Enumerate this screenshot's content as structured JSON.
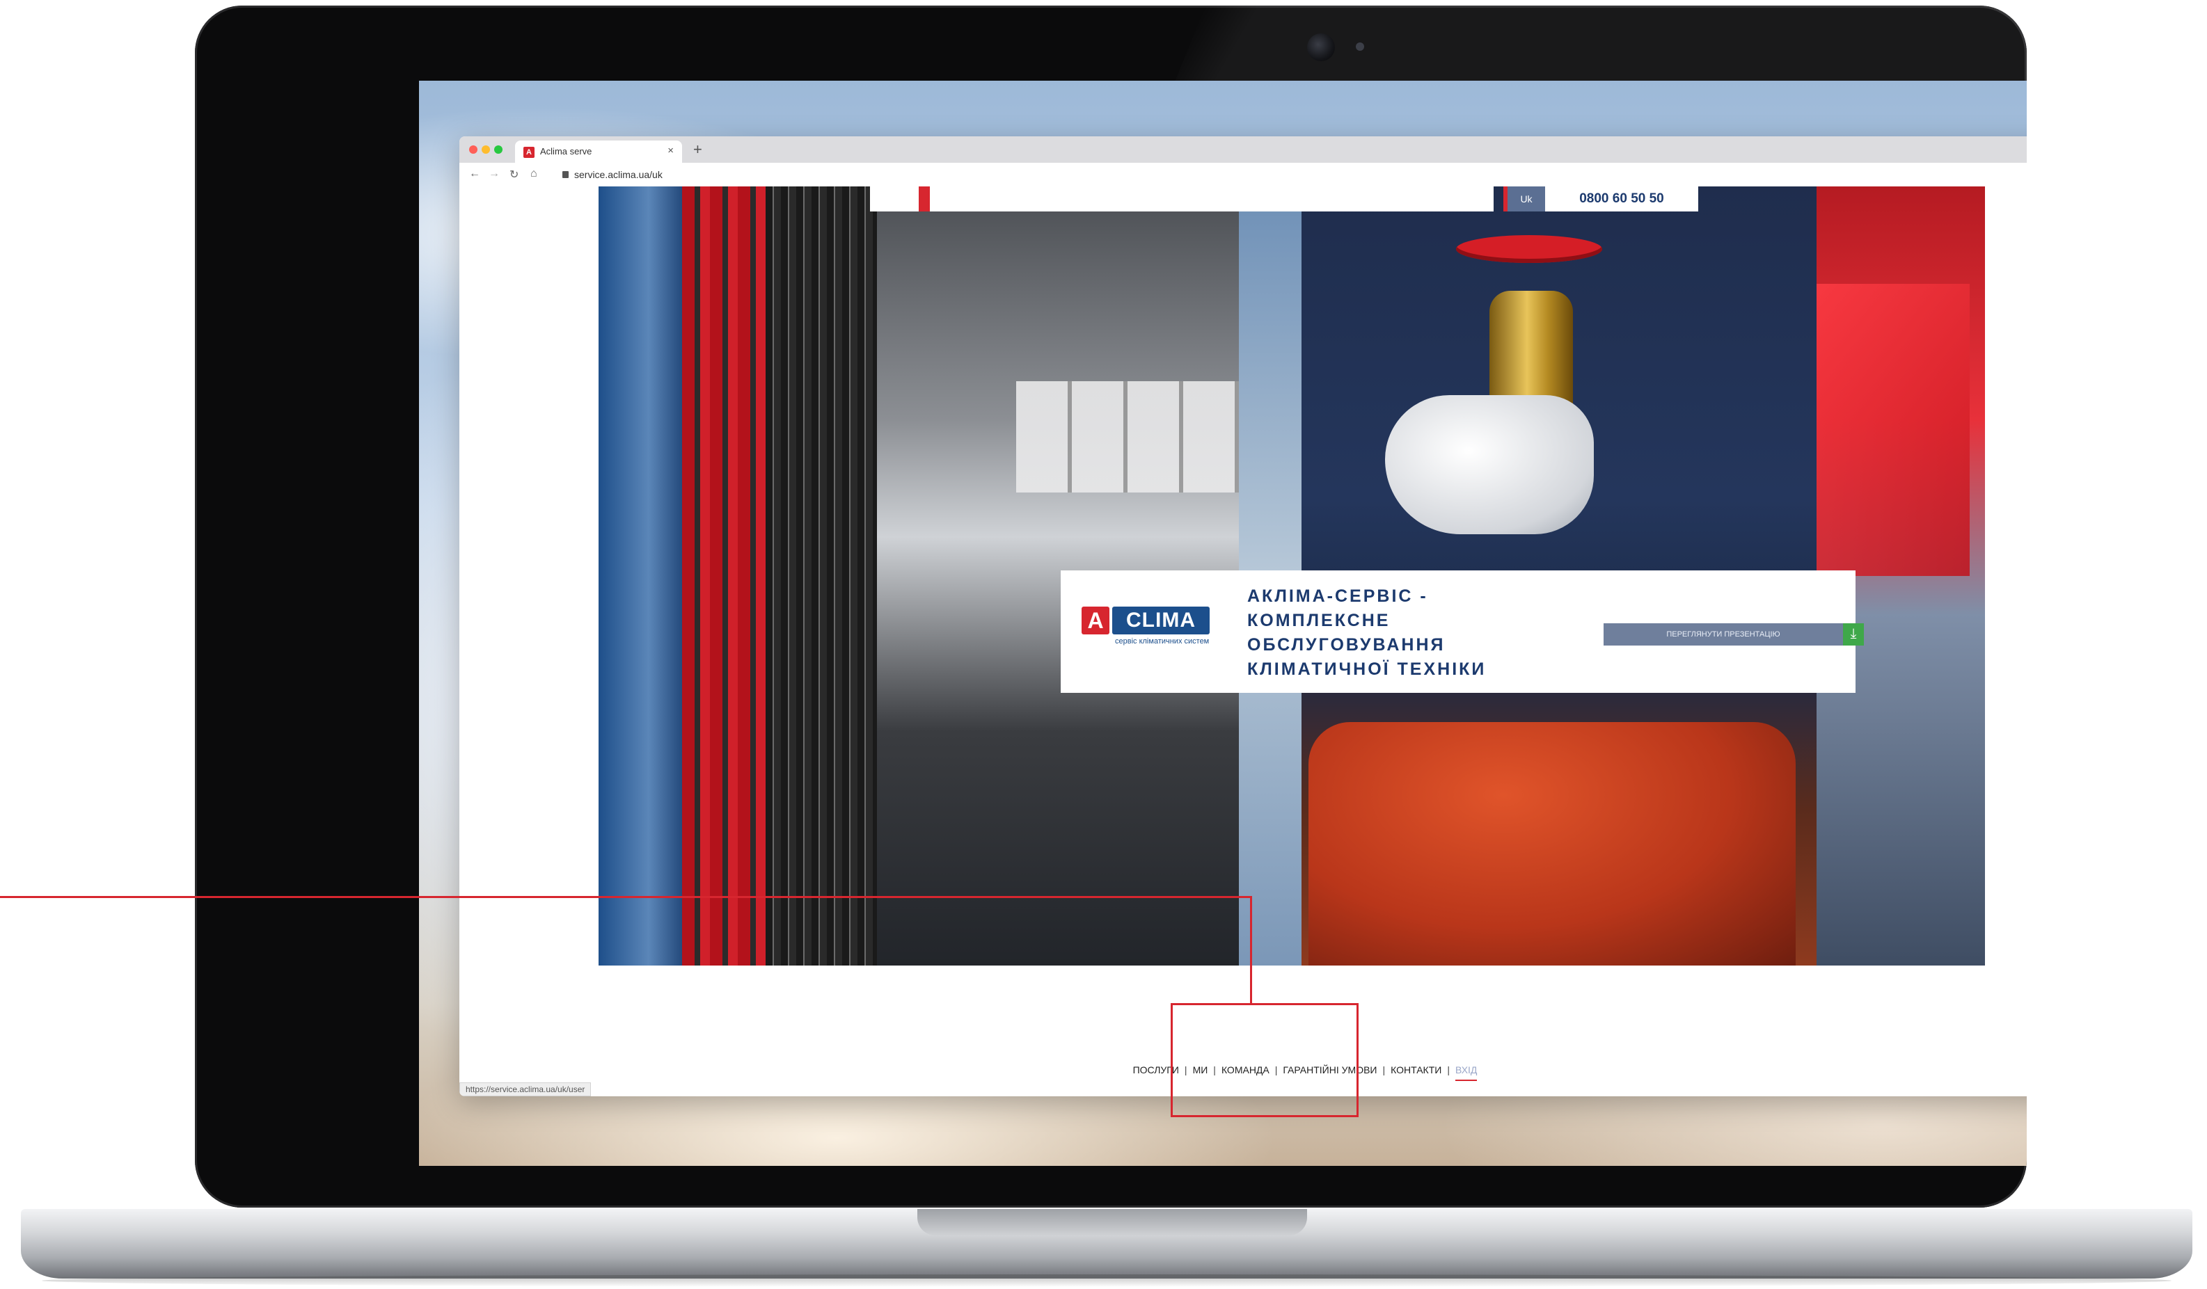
{
  "browser": {
    "tab_title": "Aclima serve",
    "tab_close": "×",
    "new_tab": "+",
    "url": "service.aclima.ua/uk",
    "status_url": "https://service.aclima.ua/uk/user"
  },
  "header": {
    "language": "Uk",
    "phone": "0800 60 50 50"
  },
  "hero": {
    "logo_a": "A",
    "logo_clima": "CLIMA",
    "logo_subtitle": "сервіс кліматичних систем",
    "heading_lines": [
      "АКЛІМА-СЕРВІС -",
      "КОМПЛЕКСНЕ",
      "ОБСЛУГОВУВАННЯ",
      "КЛІМАТИЧНОЇ ТЕХНІКИ"
    ],
    "presentation_button": "ПЕРЕГЛЯНУТИ ПРЕЗЕНТАЦІЮ"
  },
  "footer_nav": {
    "items": [
      "ПОСЛУГИ",
      "МИ",
      "КОМАНДА",
      "ГАРАНТІЙНІ УМОВИ",
      "КОНТАКТИ",
      "ВХІД"
    ],
    "separator": "|"
  },
  "icons": {
    "back": "arrow-left",
    "forward": "arrow-right",
    "reload": "reload",
    "home": "home",
    "zoom": "zoom",
    "bookmark": "star",
    "download": "download-arrow"
  },
  "colors": {
    "accent_red": "#d7262f",
    "brand_blue": "#1c4f8c",
    "heading_navy": "#1c3a6e",
    "button_grey_blue": "#6f7f9c",
    "download_green": "#3fa84a"
  }
}
